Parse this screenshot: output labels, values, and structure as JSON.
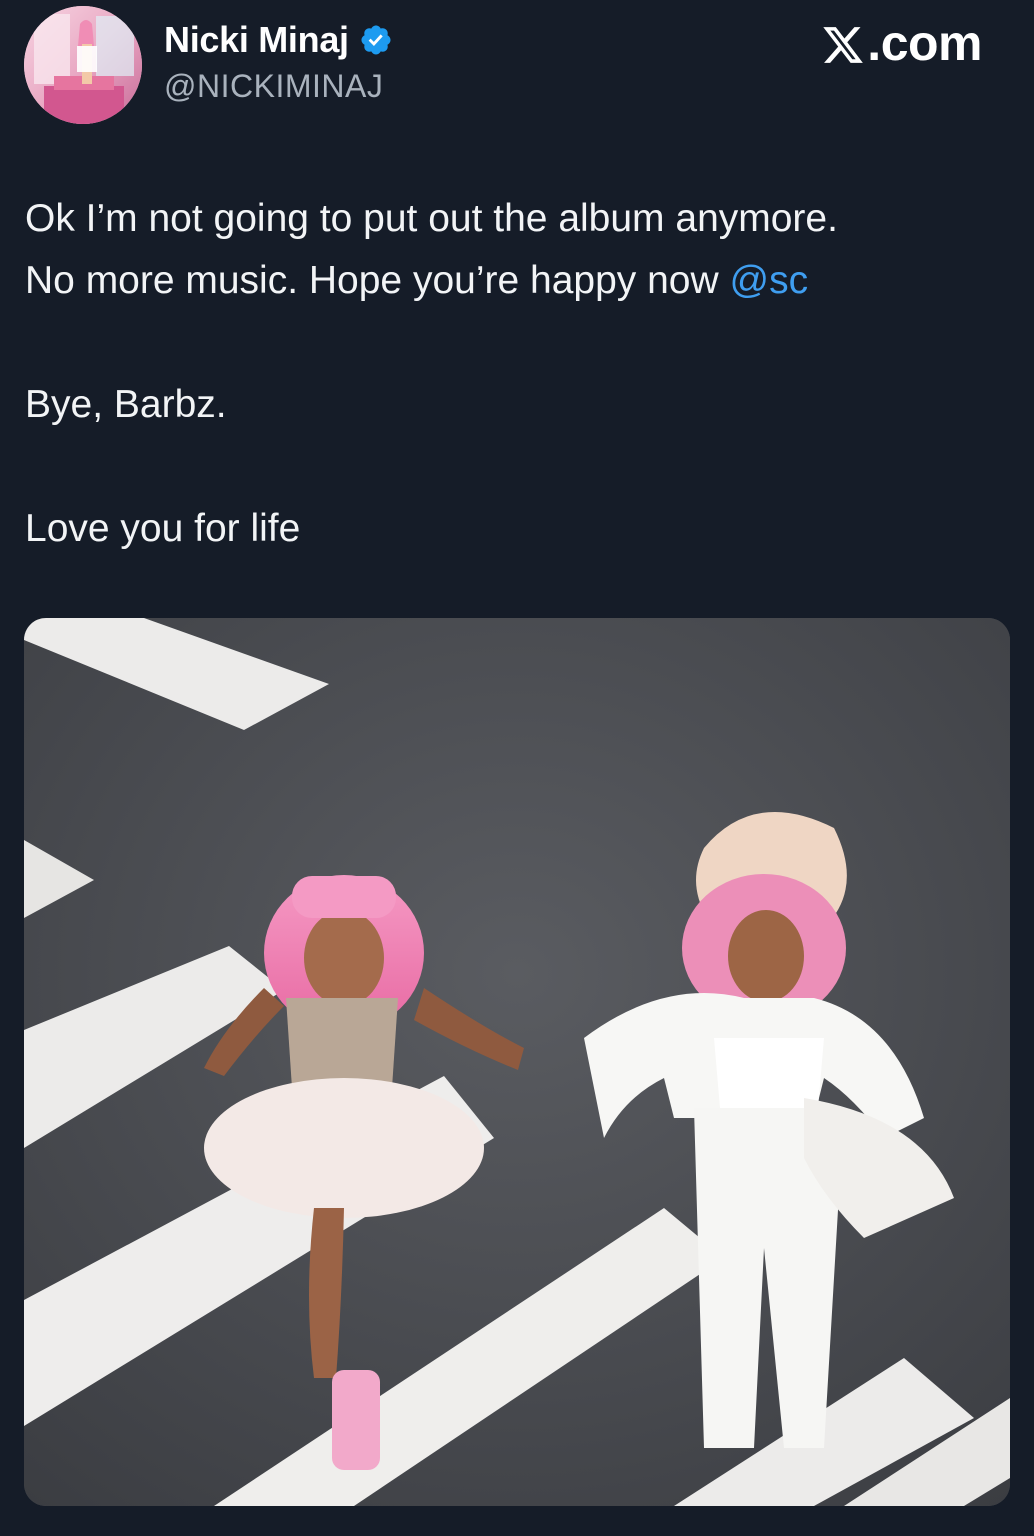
{
  "author": {
    "display_name": "Nicki Minaj",
    "handle": "@NICKIMINAJ",
    "verified": true,
    "avatar_icon": "profile-avatar"
  },
  "brand": {
    "label": "com",
    "icon": "x-logo-icon"
  },
  "tweet": {
    "line1": "Ok I’m not going to put out the album anymore.",
    "line2_prefix": "No more music. Hope you’re happy now ",
    "mention": "@sc",
    "line3": "Bye, Barbz.",
    "line4": "Love you for life"
  },
  "media": {
    "icon": "photo-crosswalk-two-women"
  },
  "colors": {
    "background": "#151c28",
    "text": "#f2f4f6",
    "secondary_text": "#a9b2bd",
    "mention": "#3f9ef0",
    "verified_badge": "#1d9bf0"
  }
}
